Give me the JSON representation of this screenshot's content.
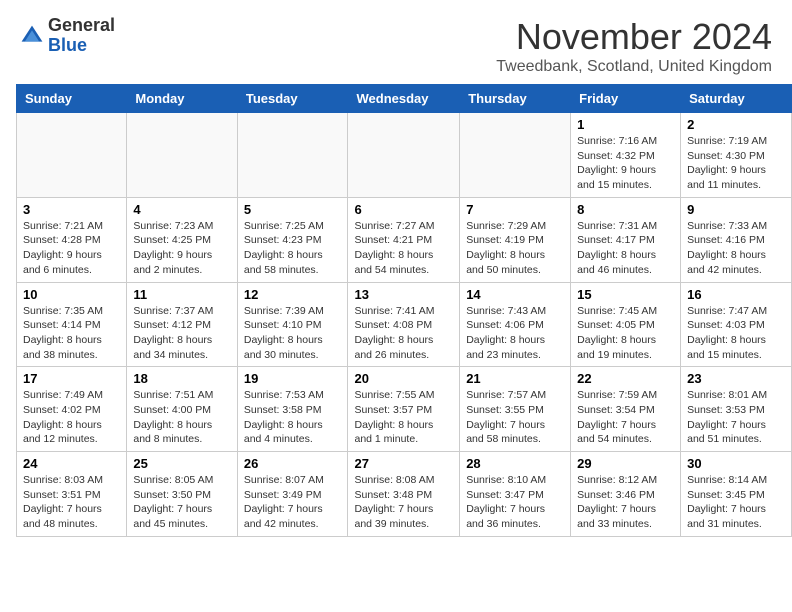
{
  "header": {
    "logo_general": "General",
    "logo_blue": "Blue",
    "title": "November 2024",
    "location": "Tweedbank, Scotland, United Kingdom"
  },
  "days_of_week": [
    "Sunday",
    "Monday",
    "Tuesday",
    "Wednesday",
    "Thursday",
    "Friday",
    "Saturday"
  ],
  "weeks": [
    [
      {
        "day": "",
        "info": ""
      },
      {
        "day": "",
        "info": ""
      },
      {
        "day": "",
        "info": ""
      },
      {
        "day": "",
        "info": ""
      },
      {
        "day": "",
        "info": ""
      },
      {
        "day": "1",
        "info": "Sunrise: 7:16 AM\nSunset: 4:32 PM\nDaylight: 9 hours and 15 minutes."
      },
      {
        "day": "2",
        "info": "Sunrise: 7:19 AM\nSunset: 4:30 PM\nDaylight: 9 hours and 11 minutes."
      }
    ],
    [
      {
        "day": "3",
        "info": "Sunrise: 7:21 AM\nSunset: 4:28 PM\nDaylight: 9 hours and 6 minutes."
      },
      {
        "day": "4",
        "info": "Sunrise: 7:23 AM\nSunset: 4:25 PM\nDaylight: 9 hours and 2 minutes."
      },
      {
        "day": "5",
        "info": "Sunrise: 7:25 AM\nSunset: 4:23 PM\nDaylight: 8 hours and 58 minutes."
      },
      {
        "day": "6",
        "info": "Sunrise: 7:27 AM\nSunset: 4:21 PM\nDaylight: 8 hours and 54 minutes."
      },
      {
        "day": "7",
        "info": "Sunrise: 7:29 AM\nSunset: 4:19 PM\nDaylight: 8 hours and 50 minutes."
      },
      {
        "day": "8",
        "info": "Sunrise: 7:31 AM\nSunset: 4:17 PM\nDaylight: 8 hours and 46 minutes."
      },
      {
        "day": "9",
        "info": "Sunrise: 7:33 AM\nSunset: 4:16 PM\nDaylight: 8 hours and 42 minutes."
      }
    ],
    [
      {
        "day": "10",
        "info": "Sunrise: 7:35 AM\nSunset: 4:14 PM\nDaylight: 8 hours and 38 minutes."
      },
      {
        "day": "11",
        "info": "Sunrise: 7:37 AM\nSunset: 4:12 PM\nDaylight: 8 hours and 34 minutes."
      },
      {
        "day": "12",
        "info": "Sunrise: 7:39 AM\nSunset: 4:10 PM\nDaylight: 8 hours and 30 minutes."
      },
      {
        "day": "13",
        "info": "Sunrise: 7:41 AM\nSunset: 4:08 PM\nDaylight: 8 hours and 26 minutes."
      },
      {
        "day": "14",
        "info": "Sunrise: 7:43 AM\nSunset: 4:06 PM\nDaylight: 8 hours and 23 minutes."
      },
      {
        "day": "15",
        "info": "Sunrise: 7:45 AM\nSunset: 4:05 PM\nDaylight: 8 hours and 19 minutes."
      },
      {
        "day": "16",
        "info": "Sunrise: 7:47 AM\nSunset: 4:03 PM\nDaylight: 8 hours and 15 minutes."
      }
    ],
    [
      {
        "day": "17",
        "info": "Sunrise: 7:49 AM\nSunset: 4:02 PM\nDaylight: 8 hours and 12 minutes."
      },
      {
        "day": "18",
        "info": "Sunrise: 7:51 AM\nSunset: 4:00 PM\nDaylight: 8 hours and 8 minutes."
      },
      {
        "day": "19",
        "info": "Sunrise: 7:53 AM\nSunset: 3:58 PM\nDaylight: 8 hours and 4 minutes."
      },
      {
        "day": "20",
        "info": "Sunrise: 7:55 AM\nSunset: 3:57 PM\nDaylight: 8 hours and 1 minute."
      },
      {
        "day": "21",
        "info": "Sunrise: 7:57 AM\nSunset: 3:55 PM\nDaylight: 7 hours and 58 minutes."
      },
      {
        "day": "22",
        "info": "Sunrise: 7:59 AM\nSunset: 3:54 PM\nDaylight: 7 hours and 54 minutes."
      },
      {
        "day": "23",
        "info": "Sunrise: 8:01 AM\nSunset: 3:53 PM\nDaylight: 7 hours and 51 minutes."
      }
    ],
    [
      {
        "day": "24",
        "info": "Sunrise: 8:03 AM\nSunset: 3:51 PM\nDaylight: 7 hours and 48 minutes."
      },
      {
        "day": "25",
        "info": "Sunrise: 8:05 AM\nSunset: 3:50 PM\nDaylight: 7 hours and 45 minutes."
      },
      {
        "day": "26",
        "info": "Sunrise: 8:07 AM\nSunset: 3:49 PM\nDaylight: 7 hours and 42 minutes."
      },
      {
        "day": "27",
        "info": "Sunrise: 8:08 AM\nSunset: 3:48 PM\nDaylight: 7 hours and 39 minutes."
      },
      {
        "day": "28",
        "info": "Sunrise: 8:10 AM\nSunset: 3:47 PM\nDaylight: 7 hours and 36 minutes."
      },
      {
        "day": "29",
        "info": "Sunrise: 8:12 AM\nSunset: 3:46 PM\nDaylight: 7 hours and 33 minutes."
      },
      {
        "day": "30",
        "info": "Sunrise: 8:14 AM\nSunset: 3:45 PM\nDaylight: 7 hours and 31 minutes."
      }
    ]
  ]
}
